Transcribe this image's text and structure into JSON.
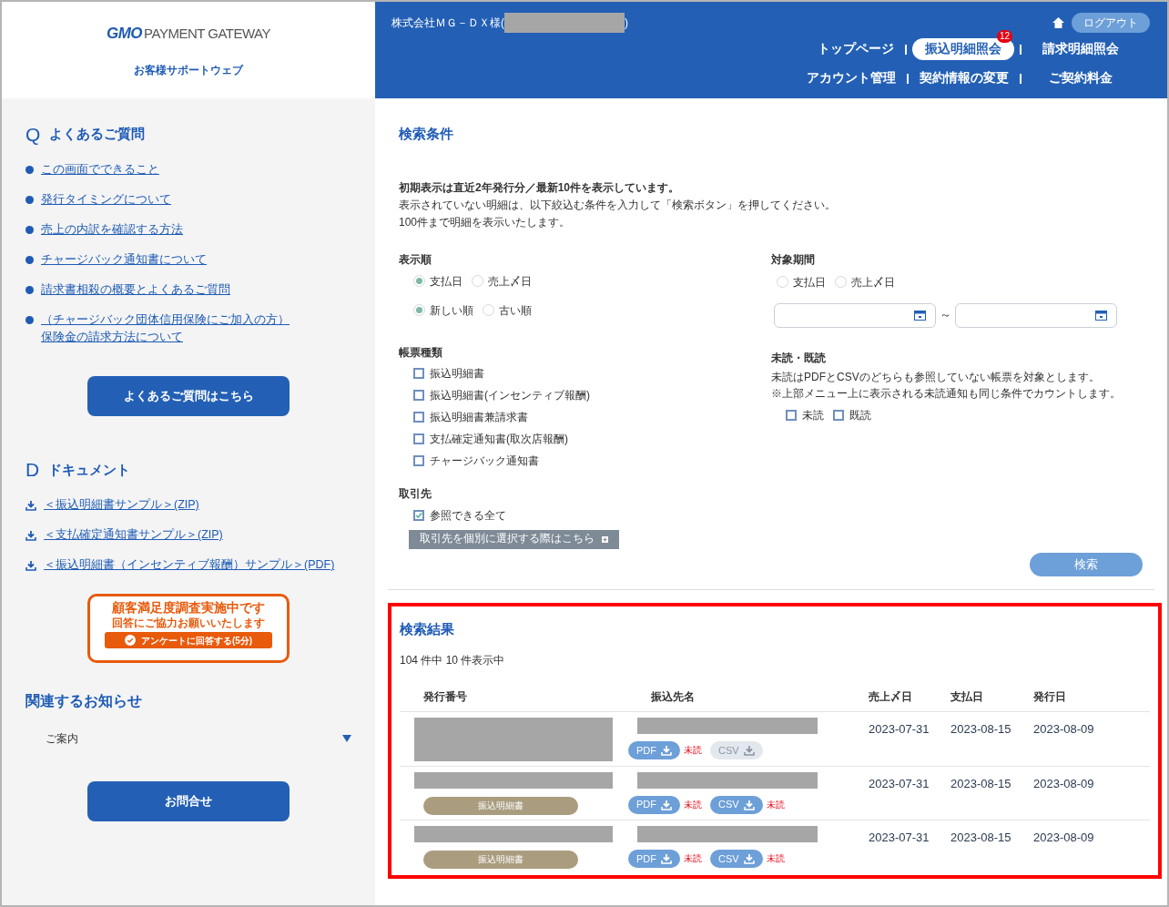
{
  "sidebar": {
    "logo": {
      "mark": "GMO",
      "name": "PAYMENT GATEWAY"
    },
    "subtitle": "お客様サポートウェブ",
    "faq": {
      "letter": "Q",
      "title": "よくあるご質問",
      "links": [
        "この画面でできること",
        "発行タイミングについて",
        "売上の内訳を確認する方法",
        "チャージバック通知書について",
        "請求書相殺の概要とよくあるご質問",
        "（チャージバック団体信用保険にご加入の方）保険金の請求方法について"
      ],
      "button": "よくあるご質問はこちら"
    },
    "documents": {
      "letter": "D",
      "title": "ドキュメント",
      "links": [
        "＜振込明細書サンプル＞(ZIP)",
        "＜支払確定通知書サンプル＞(ZIP)",
        "＜振込明細書（インセンティブ報酬）サンプル＞(PDF)"
      ]
    },
    "survey": {
      "title": "顧客満足度調査実施中です",
      "subtitle": "回答にご協力お願いいたします",
      "button": "アンケートに回答する(5分)"
    },
    "notices": {
      "title": "関連するお知らせ",
      "dropdown": "ご案内"
    },
    "contact_button": "お問合せ"
  },
  "header": {
    "company": "株式会社ＭＧ－ＤＸ様(",
    "company_end": ")",
    "logout": "ログアウト",
    "nav_rows": [
      [
        {
          "label": "トップページ",
          "selected": false
        },
        {
          "label": "振込明細照会",
          "selected": true,
          "badge": "12"
        },
        {
          "label": "請求明細照会",
          "selected": false
        }
      ],
      [
        {
          "label": "アカウント管理",
          "selected": false
        },
        {
          "label": "契約情報の変更",
          "selected": false
        },
        {
          "label": "ご契約料金",
          "selected": false
        }
      ]
    ]
  },
  "search": {
    "title": "検索条件",
    "intro": [
      "初期表示は直近2年発行分／最新10件を表示しています。",
      "表示されていない明細は、以下絞込む条件を入力して「検索ボタン」を押してください。",
      "100件まで明細を表示いたします。"
    ],
    "sort": {
      "label": "表示順",
      "groups": [
        [
          {
            "label": "支払日",
            "selected": true
          },
          {
            "label": "売上〆日",
            "selected": false
          }
        ],
        [
          {
            "label": "新しい順",
            "selected": true
          },
          {
            "label": "古い順",
            "selected": false
          }
        ]
      ]
    },
    "period": {
      "label": "対象期間",
      "options": [
        {
          "label": "支払日",
          "selected": false
        },
        {
          "label": "売上〆日",
          "selected": false
        }
      ],
      "separator": "～"
    },
    "doc_types": {
      "label": "帳票種類",
      "options": [
        {
          "label": "振込明細書",
          "checked": false
        },
        {
          "label": "振込明細書(インセンティブ報酬)",
          "checked": false
        },
        {
          "label": "振込明細書兼請求書",
          "checked": false
        },
        {
          "label": "支払確定通知書(取次店報酬)",
          "checked": false
        },
        {
          "label": "チャージバック通知書",
          "checked": false
        }
      ]
    },
    "read_status": {
      "label": "未読・既読",
      "notes": [
        "未読はPDFとCSVのどちらも参照していない帳票を対象とします。",
        "※上部メニュー上に表示される未読通知も同じ条件でカウントします。"
      ],
      "options": [
        {
          "label": "未読",
          "checked": false
        },
        {
          "label": "既読",
          "checked": false
        }
      ]
    },
    "partner": {
      "label": "取引先",
      "option": {
        "label": "参照できる全て",
        "checked": true
      },
      "button": "取引先を個別に選択する際はこちら"
    },
    "button": "検索"
  },
  "results": {
    "title": "検索結果",
    "count": "104 件中 10 件表示中",
    "columns": [
      "発行番号",
      "振込先名",
      "売上〆日",
      "支払日",
      "発行日"
    ],
    "rows": [
      {
        "pdf": {
          "label": "PDF",
          "disabled": false,
          "status": "未読"
        },
        "csv": {
          "label": "CSV",
          "disabled": true
        },
        "sales_date": "2023-07-31",
        "pay_date": "2023-08-15",
        "issue_date": "2023-08-09"
      },
      {
        "tag": "振込明細書",
        "pdf": {
          "label": "PDF",
          "disabled": false,
          "status": "未読"
        },
        "csv": {
          "label": "CSV",
          "disabled": false,
          "status": "未読"
        },
        "sales_date": "2023-07-31",
        "pay_date": "2023-08-15",
        "issue_date": "2023-08-09"
      },
      {
        "tag": "振込明細書",
        "pdf": {
          "label": "PDF",
          "disabled": false,
          "status": "未読"
        },
        "csv": {
          "label": "CSV",
          "disabled": false,
          "status": "未読"
        },
        "sales_date": "2023-07-31",
        "pay_date": "2023-08-15",
        "issue_date": "2023-08-09"
      }
    ]
  }
}
